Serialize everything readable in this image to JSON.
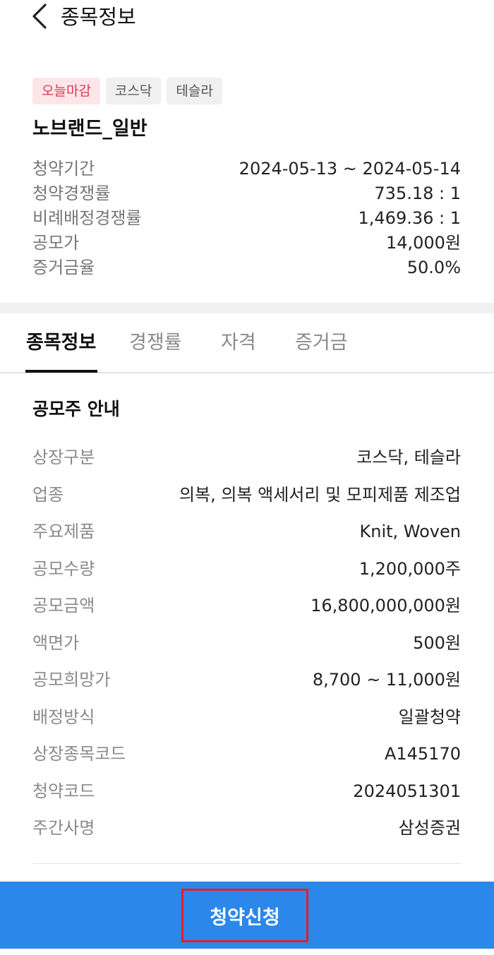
{
  "header": {
    "title": "종목정보",
    "back_icon": "chevron-left-icon"
  },
  "tags": [
    {
      "label": "오늘마감",
      "color": "#e0364f"
    },
    {
      "label": "코스닥"
    },
    {
      "label": "테슬라"
    }
  ],
  "stock_name": "노브랜드_일반",
  "summary": [
    {
      "label": "청약기간",
      "value": "2024-05-13 ~ 2024-05-14"
    },
    {
      "label": "청약경쟁률",
      "value": "735.18 : 1"
    },
    {
      "label": "비례배정경쟁률",
      "value": "1,469.36 : 1"
    },
    {
      "label": "공모가",
      "value": "14,000원"
    },
    {
      "label": "증거금율",
      "value": "50.0%"
    }
  ],
  "tabs": [
    {
      "label": "종목정보",
      "active": true
    },
    {
      "label": "경쟁률"
    },
    {
      "label": "자격"
    },
    {
      "label": "증거금"
    }
  ],
  "section_title": "공모주 안내",
  "details": [
    {
      "label": "상장구분",
      "value": "코스닥, 테슬라"
    },
    {
      "label": "업종",
      "value": "의복, 의복 액세서리 및 모피제품 제조업"
    },
    {
      "label": "주요제품",
      "value": "Knit, Woven"
    },
    {
      "label": "공모수량",
      "value": "1,200,000주"
    },
    {
      "label": "공모금액",
      "value": "16,800,000,000원"
    },
    {
      "label": "액면가",
      "value": "500원"
    },
    {
      "label": "공모희망가",
      "value": "8,700 ~ 11,000원"
    },
    {
      "label": "배정방식",
      "value": "일괄청약"
    },
    {
      "label": "상장종목코드",
      "value": "A145170"
    },
    {
      "label": "청약코드",
      "value": "2024051301"
    },
    {
      "label": "주간사명",
      "value": "삼성증권"
    }
  ],
  "cta": {
    "label": "청약신청",
    "background": "#2b87ea",
    "highlight": "#e0202a"
  }
}
